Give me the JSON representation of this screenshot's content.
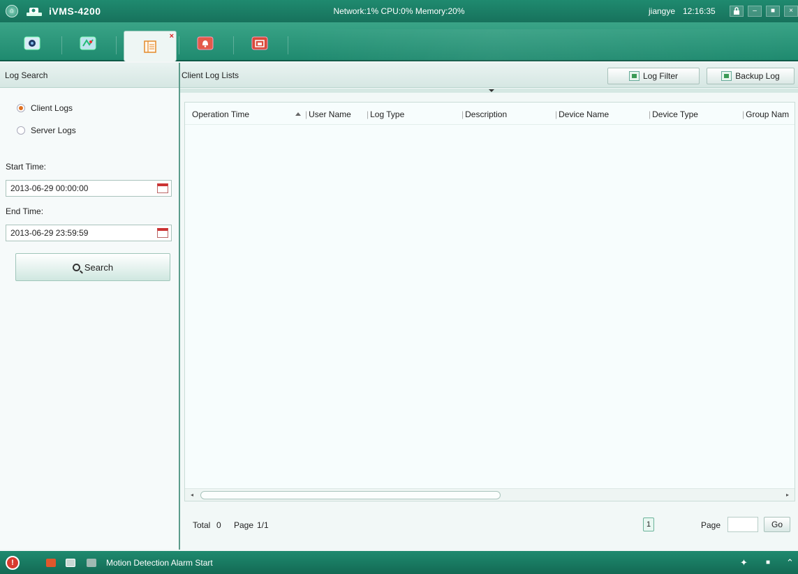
{
  "titlebar": {
    "app_name": "iVMS-4200",
    "status": "Network:1%  CPU:0%  Memory:20%",
    "user": "jiangye",
    "clock": "12:16:35",
    "lock_icon": "lock-icon",
    "minimize_glyph": "–",
    "maximize_glyph": "■",
    "close_glyph": "×"
  },
  "modules": [
    {
      "name": "main-view",
      "icon": "camera-icon"
    },
    {
      "name": "e-map",
      "icon": "map-icon"
    },
    {
      "name": "log-search",
      "icon": "log-icon",
      "active": true
    },
    {
      "name": "alarm",
      "icon": "bell-icon"
    },
    {
      "name": "record-schedule",
      "icon": "folder-icon"
    }
  ],
  "left_panel": {
    "header": "Log Search",
    "radio_client": "Client Logs",
    "radio_server": "Server Logs",
    "selected": "Client Logs",
    "start_label": "Start Time:",
    "start_value": "2013-06-29 00:00:00",
    "end_label": "End Time:",
    "end_value": "2013-06-29 23:59:59",
    "search_label": "Search"
  },
  "right_panel": {
    "header": "Client Log Lists",
    "log_filter_label": "Log Filter",
    "backup_log_label": "Backup Log",
    "columns": [
      "Operation Time",
      "User Name",
      "Log Type",
      "Description",
      "Device Name",
      "Device Type",
      "Group Nam"
    ],
    "rows": [],
    "footer": {
      "total_label": "Total",
      "total_value": "0",
      "page_label": "Page",
      "page_value": "1/1",
      "current_page": "1",
      "goto_label": "Page",
      "go_label": "Go"
    }
  },
  "alarmbar": {
    "warn_glyph": "!",
    "message": "Motion Detection Alarm Start",
    "pin_glyph": "✦",
    "restore_glyph": "■",
    "expand_glyph": "⌃"
  },
  "colors": {
    "brand_green": "#1f8a6f",
    "accent_orange": "#e07020",
    "alarm_red": "#d83a2e"
  }
}
